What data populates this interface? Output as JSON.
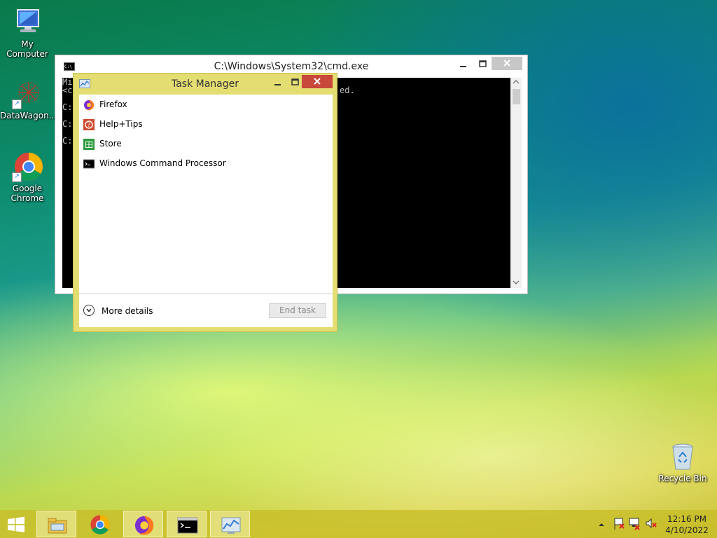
{
  "desktop": {
    "icons": [
      {
        "label": "My Computer"
      },
      {
        "label": "DataWagon..."
      },
      {
        "label_line1": "Google",
        "label_line2": "Chrome"
      },
      {
        "label": "Recycle Bin"
      }
    ]
  },
  "cmd_window": {
    "title": "C:\\Windows\\System32\\cmd.exe",
    "icon_text": "C:\\",
    "lines": [
      "Mi",
      "<c",
      "C:",
      "C:",
      "C:"
    ],
    "fragment": "ed."
  },
  "task_manager": {
    "title": "Task Manager",
    "apps": [
      {
        "label": "Firefox",
        "icon": "firefox-icon"
      },
      {
        "label": "Help+Tips",
        "icon": "help-tips-icon"
      },
      {
        "label": "Store",
        "icon": "store-icon"
      },
      {
        "label": "Windows Command Processor",
        "icon": "cmd-icon"
      }
    ],
    "more_details": "More details",
    "end_task": "End task"
  },
  "taskbar": {
    "items": [
      {
        "icon": "file-explorer-icon"
      },
      {
        "icon": "chrome-icon"
      },
      {
        "icon": "firefox-icon"
      },
      {
        "icon": "cmd-icon"
      },
      {
        "icon": "task-manager-icon"
      }
    ],
    "clock": {
      "time": "12:16 PM",
      "date": "4/10/2022"
    }
  },
  "colors": {
    "tm_frame": "#e4dd72",
    "tm_close": "#c9483c",
    "taskbar": "#c8be28"
  }
}
